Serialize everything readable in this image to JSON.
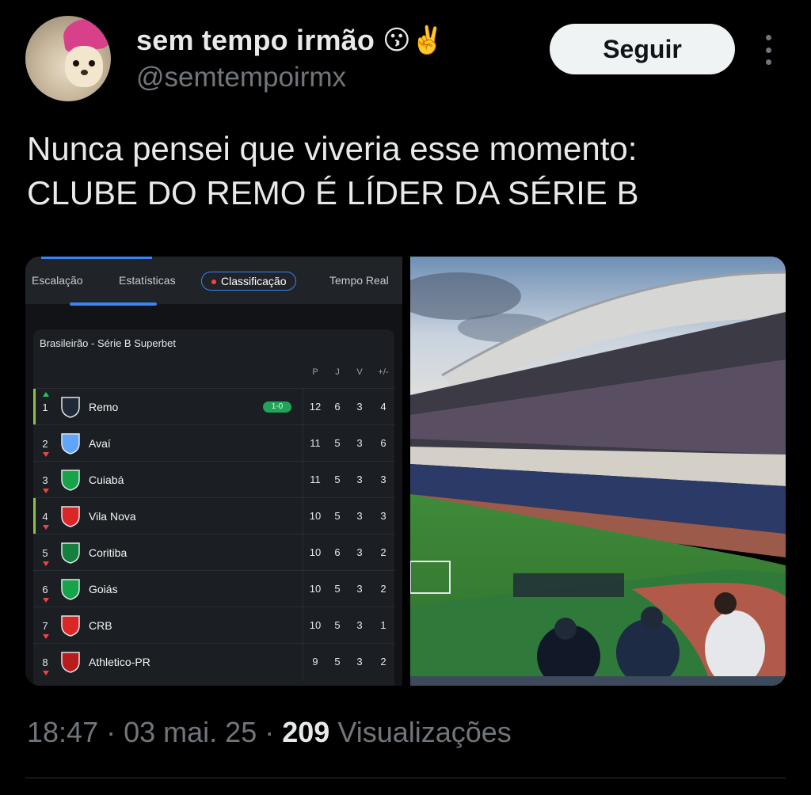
{
  "author": {
    "display_name": "sem tempo irmão",
    "emoji": "😗✌️",
    "handle": "@semtempoirmx"
  },
  "follow_label": "Seguir",
  "tweet": {
    "line1": "Nunca pensei que viveria esse momento:",
    "line2": "CLUBE DO REMO É LÍDER DA SÉRIE B"
  },
  "table_screenshot": {
    "tabs": [
      "Escalação",
      "Estatísticas",
      "Classificação",
      "Tempo Real"
    ],
    "active_tab": "Classificação",
    "league": "Brasileirão - Série B Superbet",
    "columns": [
      "P",
      "J",
      "V",
      "+/-"
    ],
    "rows": [
      {
        "pos": "1",
        "team": "Remo",
        "score": "1-0",
        "P": "12",
        "J": "6",
        "V": "3",
        "diff": "4",
        "trend": "up",
        "crest_color": "#1f2937"
      },
      {
        "pos": "2",
        "team": "Avaí",
        "P": "11",
        "J": "5",
        "V": "3",
        "diff": "6",
        "trend": "down",
        "crest_color": "#60a5fa"
      },
      {
        "pos": "3",
        "team": "Cuiabá",
        "P": "11",
        "J": "5",
        "V": "3",
        "diff": "3",
        "trend": "down",
        "crest_color": "#16a34a"
      },
      {
        "pos": "4",
        "team": "Vila Nova",
        "P": "10",
        "J": "5",
        "V": "3",
        "diff": "3",
        "trend": "down",
        "crest_color": "#dc2626"
      },
      {
        "pos": "5",
        "team": "Coritiba",
        "P": "10",
        "J": "6",
        "V": "3",
        "diff": "2",
        "trend": "down",
        "crest_color": "#15803d"
      },
      {
        "pos": "6",
        "team": "Goiás",
        "P": "10",
        "J": "5",
        "V": "3",
        "diff": "2",
        "trend": "down",
        "crest_color": "#16a34a"
      },
      {
        "pos": "7",
        "team": "CRB",
        "P": "10",
        "J": "5",
        "V": "3",
        "diff": "1",
        "trend": "down",
        "crest_color": "#dc2626"
      },
      {
        "pos": "8",
        "team": "Athletico-PR",
        "P": "9",
        "J": "5",
        "V": "3",
        "diff": "2",
        "trend": "down",
        "crest_color": "#b91c1c"
      }
    ]
  },
  "meta": {
    "time": "18:47",
    "date": "03 mai. 25",
    "views": "209",
    "views_label": "Visualizações"
  }
}
